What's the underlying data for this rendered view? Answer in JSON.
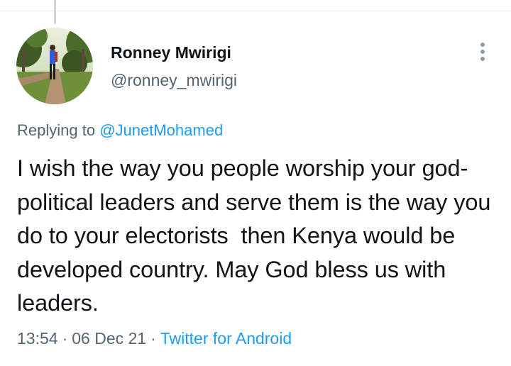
{
  "author": {
    "display_name": "Ronney Mwirigi",
    "handle": "@ronney_mwirigi",
    "avatar": "profile-photo"
  },
  "more_menu": {
    "icon": "more-vertical-icon"
  },
  "reply": {
    "prefix": "Replying to",
    "to_handle": "@JunetMohamed"
  },
  "tweet": {
    "text": "I wish the way you people worship your god- political leaders and serve them is the way you do to your electorists  then Kenya would be developed country. May God bless us with leaders."
  },
  "meta": {
    "time": "13:54",
    "separator": "·",
    "date": "06 Dec 21",
    "source": "Twitter for Android"
  },
  "colors": {
    "link": "#1d9bf0",
    "secondary_text": "#536471",
    "primary_text": "#0f1419"
  }
}
